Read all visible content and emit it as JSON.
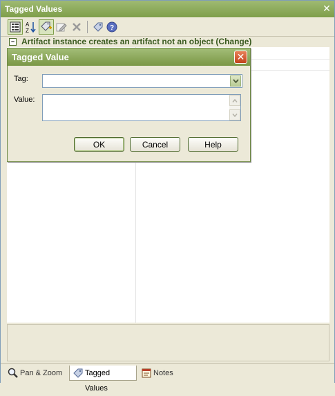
{
  "window": {
    "title": "Tagged Values",
    "close_glyph": "✕"
  },
  "toolbar": {
    "buttons": [
      {
        "icon": "categorized-view-icon"
      },
      {
        "icon": "sort-alpha-icon"
      },
      {
        "icon": "new-tag-icon"
      },
      {
        "icon": "edit-tag-icon"
      },
      {
        "icon": "delete-icon"
      },
      {
        "icon": "tag-icon"
      },
      {
        "icon": "help-icon"
      }
    ]
  },
  "section": {
    "title": "Artifact instance creates an artifact not an object (Change)",
    "toggle": "−"
  },
  "dialog": {
    "title": "Tagged Value",
    "close_glyph": "✕",
    "tag_label": "Tag:",
    "tag_value": "",
    "value_label": "Value:",
    "value_text": "",
    "ok_label": "OK",
    "cancel_label": "Cancel",
    "help_label": "Help"
  },
  "tabs": [
    {
      "label": "Pan & Zoom",
      "selected": false
    },
    {
      "label": "Tagged Values",
      "selected": true
    },
    {
      "label": "Notes",
      "selected": false
    }
  ],
  "colors": {
    "title_bar": "#8aa659",
    "accent": "#4b6b2a",
    "close_button": "#c3421c"
  }
}
